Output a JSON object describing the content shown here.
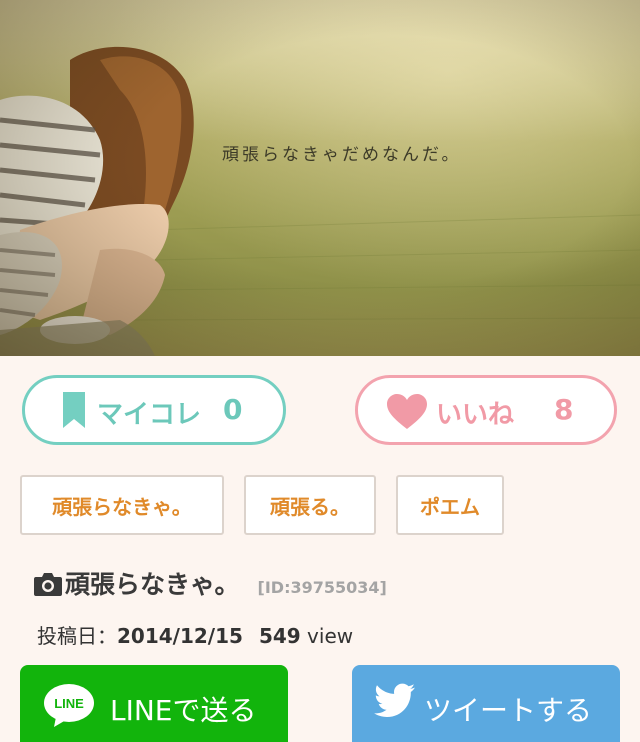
{
  "photo": {
    "caption": "頑張らなきゃだめなんだ。"
  },
  "actions": {
    "mycolle": {
      "label": "マイコレ",
      "count": "0",
      "icon": "bookmark-icon",
      "color": "#6cc8ba"
    },
    "like": {
      "label": "いいね",
      "count": "8",
      "icon": "heart-icon",
      "color": "#f19aa6"
    }
  },
  "tags": [
    "頑張らなきゃ。",
    "頑張る。",
    "ポエム"
  ],
  "post": {
    "title": "頑張らなきゃ。",
    "id": "[ID:39755034]",
    "date_label": "投稿日：",
    "date": "2014/12/15",
    "views": "549",
    "views_unit": " view"
  },
  "share": {
    "line": {
      "label": "LINEで送る",
      "badge": "LINE",
      "color": "#12b40c"
    },
    "tweet": {
      "label": "ツイートする",
      "color": "#5ba9e0"
    }
  }
}
